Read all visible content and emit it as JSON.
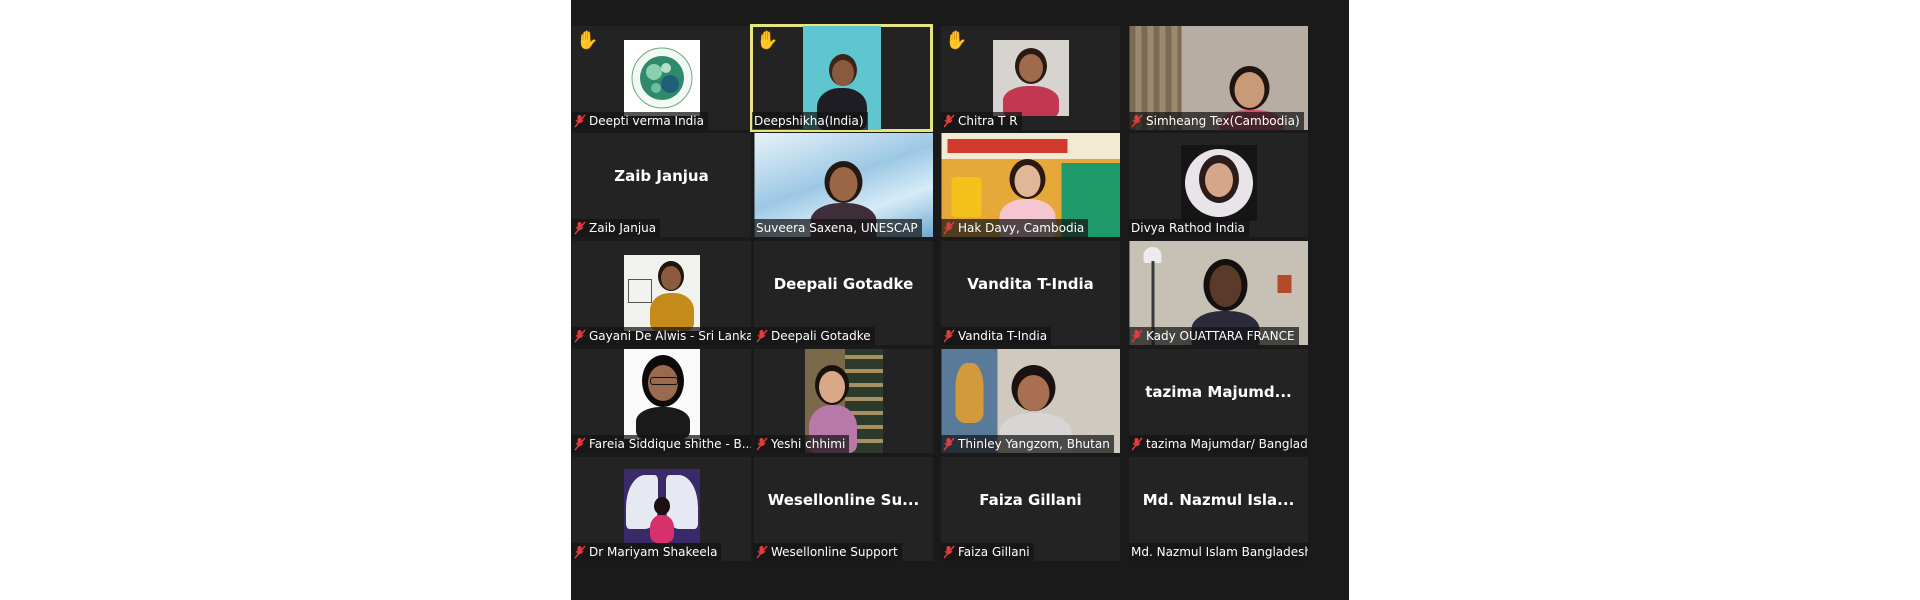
{
  "meeting": {
    "participants": [
      {
        "name": "Deepti verma India",
        "muted": true,
        "hand_raised": true,
        "type": "logo"
      },
      {
        "name": "Deepshikha(India)",
        "muted": false,
        "hand_raised": true,
        "type": "video",
        "active_speaker": true
      },
      {
        "name": "Chitra T R",
        "muted": true,
        "hand_raised": true,
        "type": "video"
      },
      {
        "name": "Simheang Tex(Cambodia)",
        "muted": true,
        "hand_raised": true,
        "type": "video"
      },
      {
        "name": "Zaib Janjua",
        "display_text": "Zaib Janjua",
        "muted": true,
        "type": "placeholder"
      },
      {
        "name": "Suveera Saxena, UNESCAP",
        "muted": false,
        "type": "video"
      },
      {
        "name": "Hak Davy, Cambodia",
        "muted": true,
        "type": "video"
      },
      {
        "name": "Divya Rathod India",
        "muted": false,
        "type": "photo"
      },
      {
        "name": "Gayani De Alwis - Sri Lanka",
        "muted": true,
        "type": "photo"
      },
      {
        "name": "Deepali Gotadke",
        "display_text": "Deepali Gotadke",
        "muted": true,
        "type": "placeholder"
      },
      {
        "name": "Vandita T-India",
        "display_text": "Vandita T-India",
        "muted": true,
        "type": "placeholder"
      },
      {
        "name": "Kady OUATTARA FRANCE",
        "muted": true,
        "type": "video"
      },
      {
        "name": "Fareia Siddique shithe  - B...",
        "muted": true,
        "type": "photo"
      },
      {
        "name": "Yeshi chhimi",
        "muted": true,
        "type": "video"
      },
      {
        "name": "Thinley Yangzom, Bhutan",
        "muted": true,
        "type": "video"
      },
      {
        "name": "tazima Majumdar/ Banglad...",
        "display_text": "tazima  Majumd...",
        "muted": true,
        "type": "placeholder"
      },
      {
        "name": "Dr Mariyam Shakeela",
        "muted": true,
        "type": "photo"
      },
      {
        "name": "Wesellonline Support",
        "display_text": "Wesellonline  Su...",
        "muted": true,
        "type": "placeholder"
      },
      {
        "name": "Faiza Gillani",
        "display_text": "Faiza Gillani",
        "muted": true,
        "type": "placeholder"
      },
      {
        "name": "Md. Nazmul Islam Bangladesh",
        "display_text": "Md.  Nazmul  Isla...",
        "muted": false,
        "type": "placeholder"
      }
    ]
  },
  "icons": {
    "hand": "raised-hand-icon",
    "mute": "muted-microphone-icon"
  },
  "colors": {
    "window_bg": "#1a1a1a",
    "tile_bg": "#232323",
    "active_border": "#e6e680",
    "mute_red": "#e23c3c",
    "hand_yellow": "#f3c23c"
  }
}
